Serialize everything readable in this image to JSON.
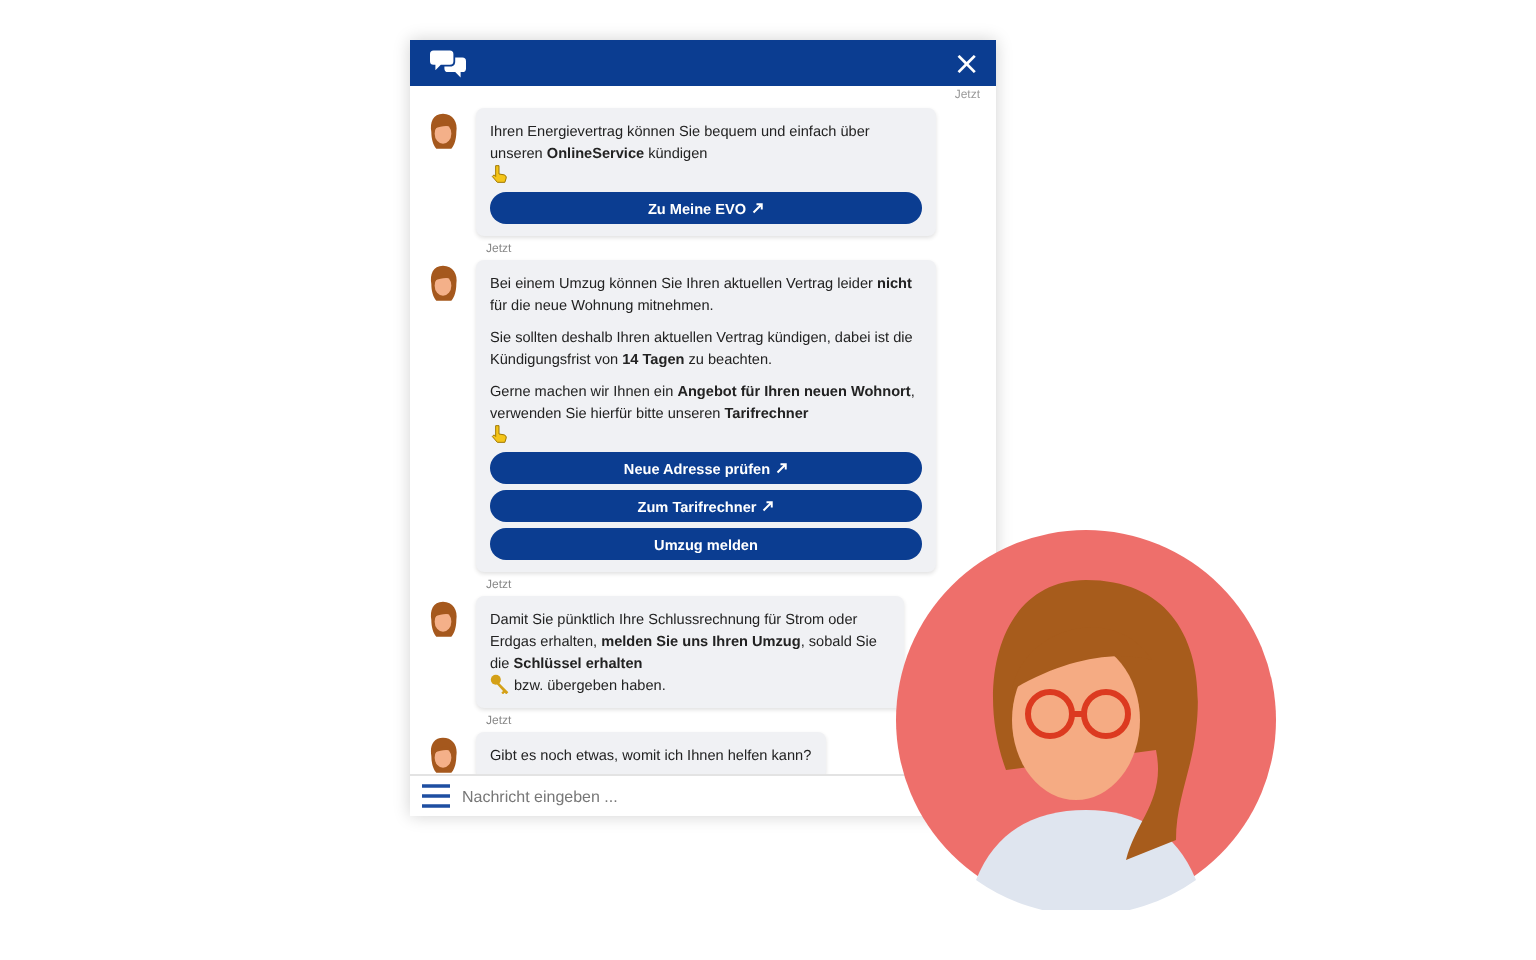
{
  "header": {
    "close": "×"
  },
  "top_time": "Jetzt",
  "messages": [
    {
      "paragraphs": [
        [
          {
            "kind": "text",
            "text": "Ihren Energievertrag können Sie bequem und einfach über unseren **OnlineService** kündigen"
          },
          {
            "kind": "hand"
          }
        ]
      ],
      "buttons": [
        {
          "label": "Zu Meine EVO",
          "external": true
        }
      ],
      "time": "Jetzt"
    },
    {
      "paragraphs": [
        [
          {
            "kind": "text",
            "text": "Bei einem Umzug können Sie Ihren aktuellen Vertrag leider **nicht** für die neue Wohnung mitnehmen."
          }
        ],
        [
          {
            "kind": "text",
            "text": "Sie sollten deshalb Ihren aktuellen Vertrag kündigen, dabei ist die Kündigungsfrist von **14 Tagen** zu beachten."
          }
        ],
        [
          {
            "kind": "text",
            "text": "Gerne machen wir Ihnen ein **Angebot für Ihren neuen Wohnort**, verwenden Sie hierfür bitte unseren **Tarifrechner**"
          },
          {
            "kind": "hand"
          }
        ]
      ],
      "buttons": [
        {
          "label": "Neue Adresse prüfen",
          "external": true
        },
        {
          "label": "Zum Tarifrechner",
          "external": true
        },
        {
          "label": "Umzug melden",
          "external": false
        }
      ],
      "time": "Jetzt"
    },
    {
      "paragraphs": [
        [
          {
            "kind": "text",
            "text": "Damit Sie pünktlich Ihre Schlussrechnung für Strom oder Erdgas erhalten, **melden Sie uns Ihren Umzug**, sobald Sie die **Schlüssel erhalten**"
          },
          {
            "kind": "key"
          },
          {
            "kind": "text",
            "text": "bzw. übergeben haben."
          }
        ]
      ],
      "time": "Jetzt"
    },
    {
      "paragraphs": [
        [
          {
            "kind": "text",
            "text": "Gibt es noch etwas, womit ich Ihnen helfen kann?"
          }
        ]
      ]
    }
  ],
  "input": {
    "placeholder": "Nachricht eingeben ..."
  }
}
